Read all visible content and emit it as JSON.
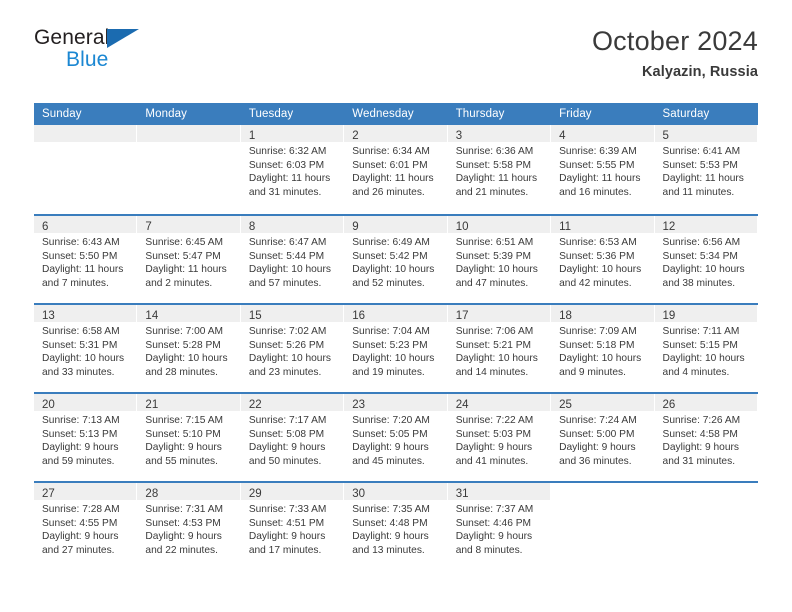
{
  "brand": {
    "word_top": "General",
    "word_bottom": "Blue",
    "triangle_color": "#1b6bb0",
    "blue_color": "#1b87d2"
  },
  "header": {
    "title": "October 2024",
    "subtitle": "Kalyazin, Russia"
  },
  "theme": {
    "header_blue": "#3a7dbd",
    "band_gray": "#efefef",
    "text": "#3a3a3a"
  },
  "weekday_headers": [
    "Sunday",
    "Monday",
    "Tuesday",
    "Wednesday",
    "Thursday",
    "Friday",
    "Saturday"
  ],
  "weeks": [
    [
      {
        "day": "",
        "sunrise": "",
        "sunset": "",
        "daylight_1": "",
        "daylight_2": ""
      },
      {
        "day": "",
        "sunrise": "",
        "sunset": "",
        "daylight_1": "",
        "daylight_2": ""
      },
      {
        "day": "1",
        "sunrise": "Sunrise: 6:32 AM",
        "sunset": "Sunset: 6:03 PM",
        "daylight_1": "Daylight: 11 hours",
        "daylight_2": "and 31 minutes."
      },
      {
        "day": "2",
        "sunrise": "Sunrise: 6:34 AM",
        "sunset": "Sunset: 6:01 PM",
        "daylight_1": "Daylight: 11 hours",
        "daylight_2": "and 26 minutes."
      },
      {
        "day": "3",
        "sunrise": "Sunrise: 6:36 AM",
        "sunset": "Sunset: 5:58 PM",
        "daylight_1": "Daylight: 11 hours",
        "daylight_2": "and 21 minutes."
      },
      {
        "day": "4",
        "sunrise": "Sunrise: 6:39 AM",
        "sunset": "Sunset: 5:55 PM",
        "daylight_1": "Daylight: 11 hours",
        "daylight_2": "and 16 minutes."
      },
      {
        "day": "5",
        "sunrise": "Sunrise: 6:41 AM",
        "sunset": "Sunset: 5:53 PM",
        "daylight_1": "Daylight: 11 hours",
        "daylight_2": "and 11 minutes."
      }
    ],
    [
      {
        "day": "6",
        "sunrise": "Sunrise: 6:43 AM",
        "sunset": "Sunset: 5:50 PM",
        "daylight_1": "Daylight: 11 hours",
        "daylight_2": "and 7 minutes."
      },
      {
        "day": "7",
        "sunrise": "Sunrise: 6:45 AM",
        "sunset": "Sunset: 5:47 PM",
        "daylight_1": "Daylight: 11 hours",
        "daylight_2": "and 2 minutes."
      },
      {
        "day": "8",
        "sunrise": "Sunrise: 6:47 AM",
        "sunset": "Sunset: 5:44 PM",
        "daylight_1": "Daylight: 10 hours",
        "daylight_2": "and 57 minutes."
      },
      {
        "day": "9",
        "sunrise": "Sunrise: 6:49 AM",
        "sunset": "Sunset: 5:42 PM",
        "daylight_1": "Daylight: 10 hours",
        "daylight_2": "and 52 minutes."
      },
      {
        "day": "10",
        "sunrise": "Sunrise: 6:51 AM",
        "sunset": "Sunset: 5:39 PM",
        "daylight_1": "Daylight: 10 hours",
        "daylight_2": "and 47 minutes."
      },
      {
        "day": "11",
        "sunrise": "Sunrise: 6:53 AM",
        "sunset": "Sunset: 5:36 PM",
        "daylight_1": "Daylight: 10 hours",
        "daylight_2": "and 42 minutes."
      },
      {
        "day": "12",
        "sunrise": "Sunrise: 6:56 AM",
        "sunset": "Sunset: 5:34 PM",
        "daylight_1": "Daylight: 10 hours",
        "daylight_2": "and 38 minutes."
      }
    ],
    [
      {
        "day": "13",
        "sunrise": "Sunrise: 6:58 AM",
        "sunset": "Sunset: 5:31 PM",
        "daylight_1": "Daylight: 10 hours",
        "daylight_2": "and 33 minutes."
      },
      {
        "day": "14",
        "sunrise": "Sunrise: 7:00 AM",
        "sunset": "Sunset: 5:28 PM",
        "daylight_1": "Daylight: 10 hours",
        "daylight_2": "and 28 minutes."
      },
      {
        "day": "15",
        "sunrise": "Sunrise: 7:02 AM",
        "sunset": "Sunset: 5:26 PM",
        "daylight_1": "Daylight: 10 hours",
        "daylight_2": "and 23 minutes."
      },
      {
        "day": "16",
        "sunrise": "Sunrise: 7:04 AM",
        "sunset": "Sunset: 5:23 PM",
        "daylight_1": "Daylight: 10 hours",
        "daylight_2": "and 19 minutes."
      },
      {
        "day": "17",
        "sunrise": "Sunrise: 7:06 AM",
        "sunset": "Sunset: 5:21 PM",
        "daylight_1": "Daylight: 10 hours",
        "daylight_2": "and 14 minutes."
      },
      {
        "day": "18",
        "sunrise": "Sunrise: 7:09 AM",
        "sunset": "Sunset: 5:18 PM",
        "daylight_1": "Daylight: 10 hours",
        "daylight_2": "and 9 minutes."
      },
      {
        "day": "19",
        "sunrise": "Sunrise: 7:11 AM",
        "sunset": "Sunset: 5:15 PM",
        "daylight_1": "Daylight: 10 hours",
        "daylight_2": "and 4 minutes."
      }
    ],
    [
      {
        "day": "20",
        "sunrise": "Sunrise: 7:13 AM",
        "sunset": "Sunset: 5:13 PM",
        "daylight_1": "Daylight: 9 hours",
        "daylight_2": "and 59 minutes."
      },
      {
        "day": "21",
        "sunrise": "Sunrise: 7:15 AM",
        "sunset": "Sunset: 5:10 PM",
        "daylight_1": "Daylight: 9 hours",
        "daylight_2": "and 55 minutes."
      },
      {
        "day": "22",
        "sunrise": "Sunrise: 7:17 AM",
        "sunset": "Sunset: 5:08 PM",
        "daylight_1": "Daylight: 9 hours",
        "daylight_2": "and 50 minutes."
      },
      {
        "day": "23",
        "sunrise": "Sunrise: 7:20 AM",
        "sunset": "Sunset: 5:05 PM",
        "daylight_1": "Daylight: 9 hours",
        "daylight_2": "and 45 minutes."
      },
      {
        "day": "24",
        "sunrise": "Sunrise: 7:22 AM",
        "sunset": "Sunset: 5:03 PM",
        "daylight_1": "Daylight: 9 hours",
        "daylight_2": "and 41 minutes."
      },
      {
        "day": "25",
        "sunrise": "Sunrise: 7:24 AM",
        "sunset": "Sunset: 5:00 PM",
        "daylight_1": "Daylight: 9 hours",
        "daylight_2": "and 36 minutes."
      },
      {
        "day": "26",
        "sunrise": "Sunrise: 7:26 AM",
        "sunset": "Sunset: 4:58 PM",
        "daylight_1": "Daylight: 9 hours",
        "daylight_2": "and 31 minutes."
      }
    ],
    [
      {
        "day": "27",
        "sunrise": "Sunrise: 7:28 AM",
        "sunset": "Sunset: 4:55 PM",
        "daylight_1": "Daylight: 9 hours",
        "daylight_2": "and 27 minutes."
      },
      {
        "day": "28",
        "sunrise": "Sunrise: 7:31 AM",
        "sunset": "Sunset: 4:53 PM",
        "daylight_1": "Daylight: 9 hours",
        "daylight_2": "and 22 minutes."
      },
      {
        "day": "29",
        "sunrise": "Sunrise: 7:33 AM",
        "sunset": "Sunset: 4:51 PM",
        "daylight_1": "Daylight: 9 hours",
        "daylight_2": "and 17 minutes."
      },
      {
        "day": "30",
        "sunrise": "Sunrise: 7:35 AM",
        "sunset": "Sunset: 4:48 PM",
        "daylight_1": "Daylight: 9 hours",
        "daylight_2": "and 13 minutes."
      },
      {
        "day": "31",
        "sunrise": "Sunrise: 7:37 AM",
        "sunset": "Sunset: 4:46 PM",
        "daylight_1": "Daylight: 9 hours",
        "daylight_2": "and 8 minutes."
      },
      {
        "day": "",
        "sunrise": "",
        "sunset": "",
        "daylight_1": "",
        "daylight_2": ""
      },
      {
        "day": "",
        "sunrise": "",
        "sunset": "",
        "daylight_1": "",
        "daylight_2": ""
      }
    ]
  ]
}
